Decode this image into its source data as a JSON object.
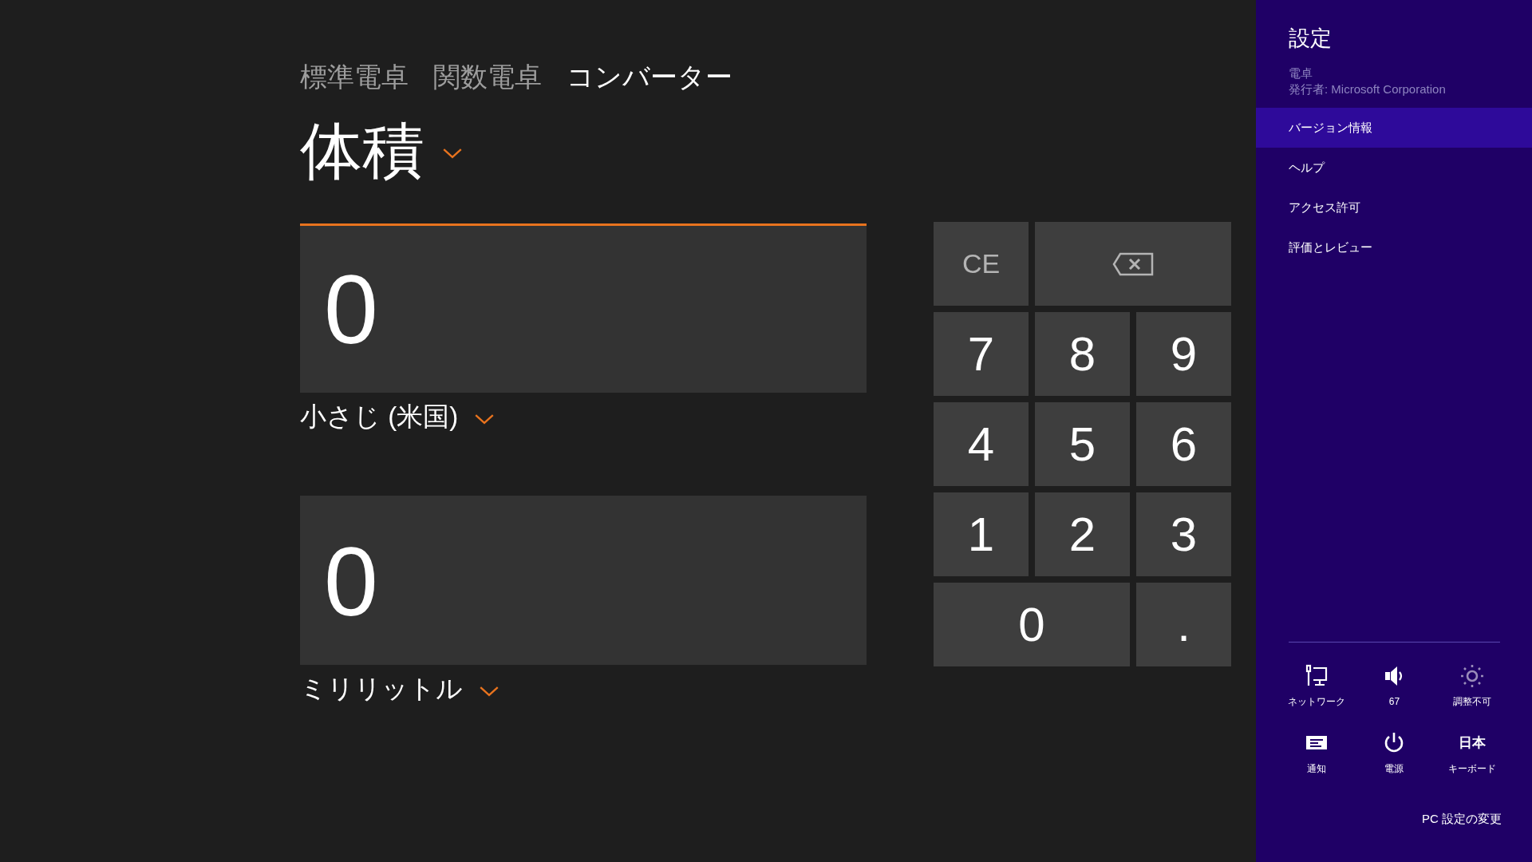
{
  "tabs": [
    {
      "label": "標準電卓",
      "selected": false
    },
    {
      "label": "関数電卓",
      "selected": false
    },
    {
      "label": "コンバーター",
      "selected": true
    }
  ],
  "category": {
    "label": "体積"
  },
  "fields": [
    {
      "value": "0",
      "unit": "小さじ (米国)",
      "focused": true
    },
    {
      "value": "0",
      "unit": "ミリリットル",
      "focused": false
    }
  ],
  "keypad": [
    {
      "kind": "digit",
      "label": "CE",
      "disabled": true
    },
    {
      "kind": "backspace",
      "disabled": true
    },
    {
      "kind": "digit",
      "label": "7",
      "disabled": false
    },
    {
      "kind": "digit",
      "label": "8",
      "disabled": false
    },
    {
      "kind": "digit",
      "label": "9",
      "disabled": false
    },
    {
      "kind": "digit",
      "label": "4",
      "disabled": false
    },
    {
      "kind": "digit",
      "label": "5",
      "disabled": false
    },
    {
      "kind": "digit",
      "label": "6",
      "disabled": false
    },
    {
      "kind": "digit",
      "label": "1",
      "disabled": false
    },
    {
      "kind": "digit",
      "label": "2",
      "disabled": false
    },
    {
      "kind": "digit",
      "label": "3",
      "disabled": false
    },
    {
      "kind": "wide",
      "label": "0",
      "disabled": false
    },
    {
      "kind": "digit",
      "label": ".",
      "disabled": false
    }
  ],
  "settings": {
    "title": "設定",
    "app_name": "電卓",
    "publisher": "発行者: Microsoft Corporation",
    "items": [
      {
        "label": "バージョン情報",
        "selected": true
      },
      {
        "label": "ヘルプ",
        "selected": false
      },
      {
        "label": "アクセス許可",
        "selected": false
      },
      {
        "label": "評価とレビュー",
        "selected": false
      }
    ],
    "tiles": [
      {
        "kind": "network",
        "label": "ネットワーク",
        "disabled": false
      },
      {
        "kind": "volume",
        "label": "67",
        "disabled": false
      },
      {
        "kind": "brightness",
        "label": "調整不可",
        "disabled": true
      },
      {
        "kind": "notifications",
        "label": "通知",
        "disabled": false
      },
      {
        "kind": "power",
        "label": "電源",
        "disabled": false
      },
      {
        "kind": "keyboard",
        "glyph": "日本",
        "label": "キーボード",
        "disabled": false
      }
    ],
    "pc_settings_link": "PC 設定の変更"
  }
}
